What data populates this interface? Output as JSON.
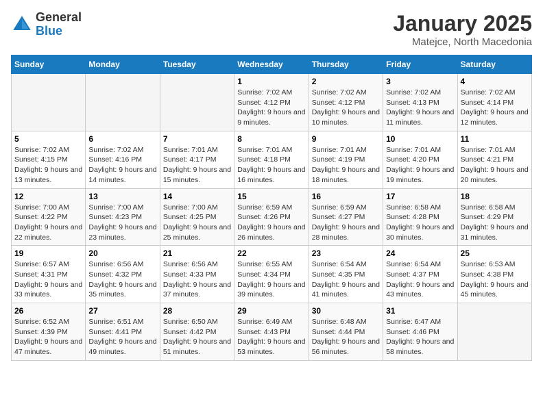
{
  "header": {
    "logo_general": "General",
    "logo_blue": "Blue",
    "month_title": "January 2025",
    "subtitle": "Matejce, North Macedonia"
  },
  "weekdays": [
    "Sunday",
    "Monday",
    "Tuesday",
    "Wednesday",
    "Thursday",
    "Friday",
    "Saturday"
  ],
  "weeks": [
    [
      {
        "day": "",
        "info": ""
      },
      {
        "day": "",
        "info": ""
      },
      {
        "day": "",
        "info": ""
      },
      {
        "day": "1",
        "info": "Sunrise: 7:02 AM\nSunset: 4:12 PM\nDaylight: 9 hours and 9 minutes."
      },
      {
        "day": "2",
        "info": "Sunrise: 7:02 AM\nSunset: 4:12 PM\nDaylight: 9 hours and 10 minutes."
      },
      {
        "day": "3",
        "info": "Sunrise: 7:02 AM\nSunset: 4:13 PM\nDaylight: 9 hours and 11 minutes."
      },
      {
        "day": "4",
        "info": "Sunrise: 7:02 AM\nSunset: 4:14 PM\nDaylight: 9 hours and 12 minutes."
      }
    ],
    [
      {
        "day": "5",
        "info": "Sunrise: 7:02 AM\nSunset: 4:15 PM\nDaylight: 9 hours and 13 minutes."
      },
      {
        "day": "6",
        "info": "Sunrise: 7:02 AM\nSunset: 4:16 PM\nDaylight: 9 hours and 14 minutes."
      },
      {
        "day": "7",
        "info": "Sunrise: 7:01 AM\nSunset: 4:17 PM\nDaylight: 9 hours and 15 minutes."
      },
      {
        "day": "8",
        "info": "Sunrise: 7:01 AM\nSunset: 4:18 PM\nDaylight: 9 hours and 16 minutes."
      },
      {
        "day": "9",
        "info": "Sunrise: 7:01 AM\nSunset: 4:19 PM\nDaylight: 9 hours and 18 minutes."
      },
      {
        "day": "10",
        "info": "Sunrise: 7:01 AM\nSunset: 4:20 PM\nDaylight: 9 hours and 19 minutes."
      },
      {
        "day": "11",
        "info": "Sunrise: 7:01 AM\nSunset: 4:21 PM\nDaylight: 9 hours and 20 minutes."
      }
    ],
    [
      {
        "day": "12",
        "info": "Sunrise: 7:00 AM\nSunset: 4:22 PM\nDaylight: 9 hours and 22 minutes."
      },
      {
        "day": "13",
        "info": "Sunrise: 7:00 AM\nSunset: 4:23 PM\nDaylight: 9 hours and 23 minutes."
      },
      {
        "day": "14",
        "info": "Sunrise: 7:00 AM\nSunset: 4:25 PM\nDaylight: 9 hours and 25 minutes."
      },
      {
        "day": "15",
        "info": "Sunrise: 6:59 AM\nSunset: 4:26 PM\nDaylight: 9 hours and 26 minutes."
      },
      {
        "day": "16",
        "info": "Sunrise: 6:59 AM\nSunset: 4:27 PM\nDaylight: 9 hours and 28 minutes."
      },
      {
        "day": "17",
        "info": "Sunrise: 6:58 AM\nSunset: 4:28 PM\nDaylight: 9 hours and 30 minutes."
      },
      {
        "day": "18",
        "info": "Sunrise: 6:58 AM\nSunset: 4:29 PM\nDaylight: 9 hours and 31 minutes."
      }
    ],
    [
      {
        "day": "19",
        "info": "Sunrise: 6:57 AM\nSunset: 4:31 PM\nDaylight: 9 hours and 33 minutes."
      },
      {
        "day": "20",
        "info": "Sunrise: 6:56 AM\nSunset: 4:32 PM\nDaylight: 9 hours and 35 minutes."
      },
      {
        "day": "21",
        "info": "Sunrise: 6:56 AM\nSunset: 4:33 PM\nDaylight: 9 hours and 37 minutes."
      },
      {
        "day": "22",
        "info": "Sunrise: 6:55 AM\nSunset: 4:34 PM\nDaylight: 9 hours and 39 minutes."
      },
      {
        "day": "23",
        "info": "Sunrise: 6:54 AM\nSunset: 4:35 PM\nDaylight: 9 hours and 41 minutes."
      },
      {
        "day": "24",
        "info": "Sunrise: 6:54 AM\nSunset: 4:37 PM\nDaylight: 9 hours and 43 minutes."
      },
      {
        "day": "25",
        "info": "Sunrise: 6:53 AM\nSunset: 4:38 PM\nDaylight: 9 hours and 45 minutes."
      }
    ],
    [
      {
        "day": "26",
        "info": "Sunrise: 6:52 AM\nSunset: 4:39 PM\nDaylight: 9 hours and 47 minutes."
      },
      {
        "day": "27",
        "info": "Sunrise: 6:51 AM\nSunset: 4:41 PM\nDaylight: 9 hours and 49 minutes."
      },
      {
        "day": "28",
        "info": "Sunrise: 6:50 AM\nSunset: 4:42 PM\nDaylight: 9 hours and 51 minutes."
      },
      {
        "day": "29",
        "info": "Sunrise: 6:49 AM\nSunset: 4:43 PM\nDaylight: 9 hours and 53 minutes."
      },
      {
        "day": "30",
        "info": "Sunrise: 6:48 AM\nSunset: 4:44 PM\nDaylight: 9 hours and 56 minutes."
      },
      {
        "day": "31",
        "info": "Sunrise: 6:47 AM\nSunset: 4:46 PM\nDaylight: 9 hours and 58 minutes."
      },
      {
        "day": "",
        "info": ""
      }
    ]
  ]
}
